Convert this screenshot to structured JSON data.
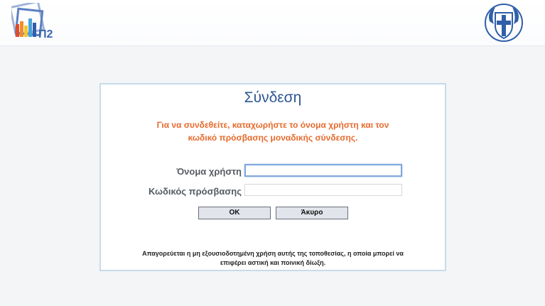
{
  "header": {
    "left_logo": "site-logo-icon",
    "right_logo": "greek-coat-of-arms-icon"
  },
  "login": {
    "title": "Σύνδεση",
    "instructions_line1": "Για να συνδεθείτε, καταχωρήστε το όνομα χρήστη και τον",
    "instructions_line2": "κωδικό πρόσβασης μοναδικής σύνδεσης.",
    "username_label": "Όνομα χρήστη",
    "username_value": "",
    "password_label": "Κωδικός πρόσβασης",
    "password_value": "",
    "ok_label": "OK",
    "cancel_label": "Άκυρο",
    "warning_line1": "Απαγορεύεται η μη εξουσιοδοτημένη χρήση αυτής της τοποθεσίας, η οποία μπορεί να",
    "warning_line2": "επιφέρει αστική και ποινική δίωξη."
  },
  "colors": {
    "title": "#2b5693",
    "instructions": "#e66a2c",
    "box_border": "#c7dbe9"
  }
}
